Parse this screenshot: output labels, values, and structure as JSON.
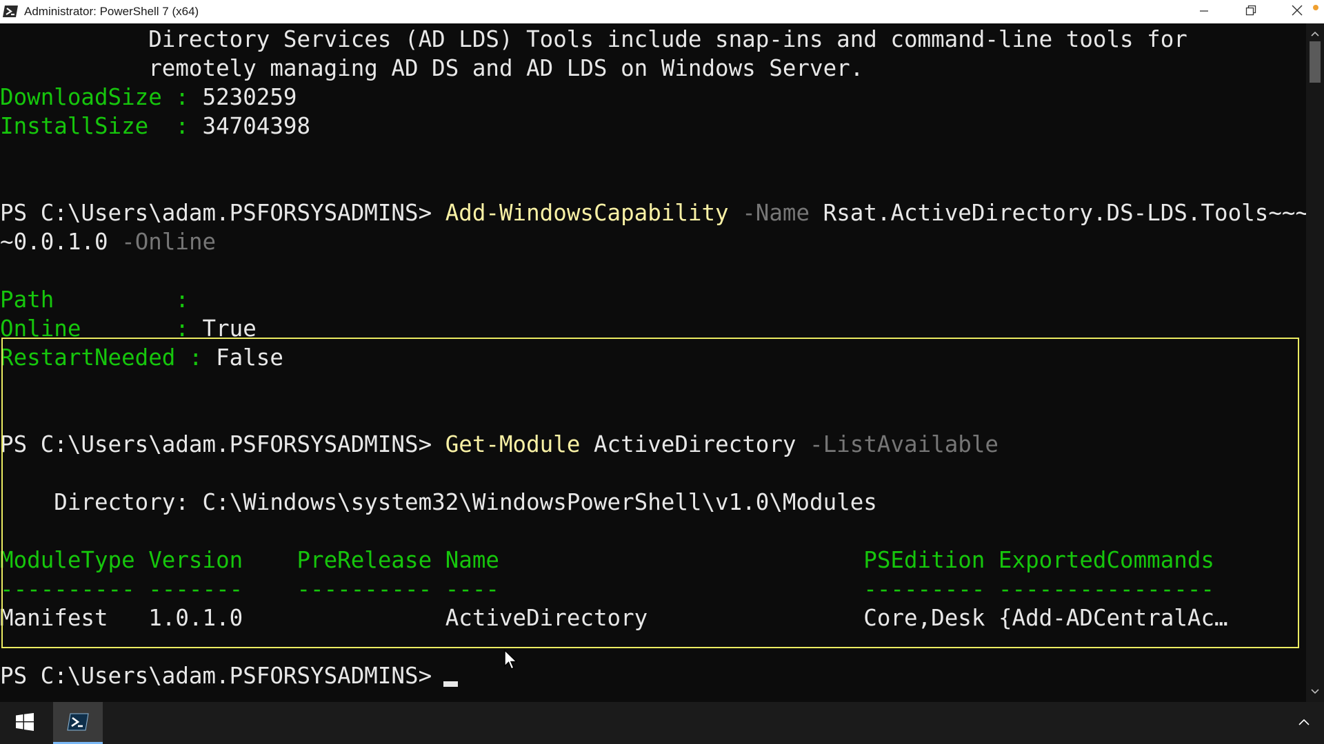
{
  "window": {
    "title": "Administrator: PowerShell 7 (x64)",
    "icons": {
      "app": "powershell-icon",
      "minimize": "minimize-icon",
      "maximize": "restore-icon",
      "close": "close-icon"
    }
  },
  "terminal": {
    "prompt": "PS C:\\Users\\adam.PSFORSYSADMINS>",
    "desc_line1": "           Directory Services (AD LDS) Tools include snap-ins and command-line tools for",
    "desc_line2": "           remotely managing AD DS and AD LDS on Windows Server.",
    "download_key": "DownloadSize",
    "download_sep": " : ",
    "download_value": "5230259",
    "install_key": "InstallSize",
    "install_sep": "  : ",
    "install_value": "34704398",
    "cmd1": {
      "command": "Add-WindowsCapability",
      "param1": "-Name",
      "arg1": "Rsat.ActiveDirectory.DS-LDS.Tools~~~",
      "arg1_cont": "~0.0.1.0",
      "param2": "-Online"
    },
    "result1": {
      "path_key": "Path",
      "path_sep": "         :",
      "online_key": "Online",
      "online_sep": "       : ",
      "online_value": "True",
      "restart_key": "RestartNeeded",
      "restart_sep": " : ",
      "restart_value": "False"
    },
    "cmd2": {
      "command": "Get-Module",
      "arg": "ActiveDirectory",
      "param": "-ListAvailable"
    },
    "directory_line": "    Directory: C:\\Windows\\system32\\WindowsPowerShell\\v1.0\\Modules",
    "table": {
      "header": "ModuleType Version    PreRelease Name                           PSEdition ExportedCommands",
      "separator": "---------- -------    ---------- ----                           --------- ----------------",
      "row_type": "Manifest",
      "row_version": "1.0.1.0",
      "row_name": "ActiveDirectory",
      "row_edition": "Core,Desk",
      "row_commands": "{Add-ADCentralAc…"
    }
  },
  "taskbar": {
    "start_icon": "windows-logo-icon",
    "app_icon": "powershell-icon",
    "tray_icon": "chevron-up-icon"
  },
  "colors": {
    "background": "#0c0c0c",
    "property_green": "#16c60c",
    "command_yellow": "#f9f1a5",
    "parameter_gray": "#767676",
    "highlight": "#ecec62"
  }
}
